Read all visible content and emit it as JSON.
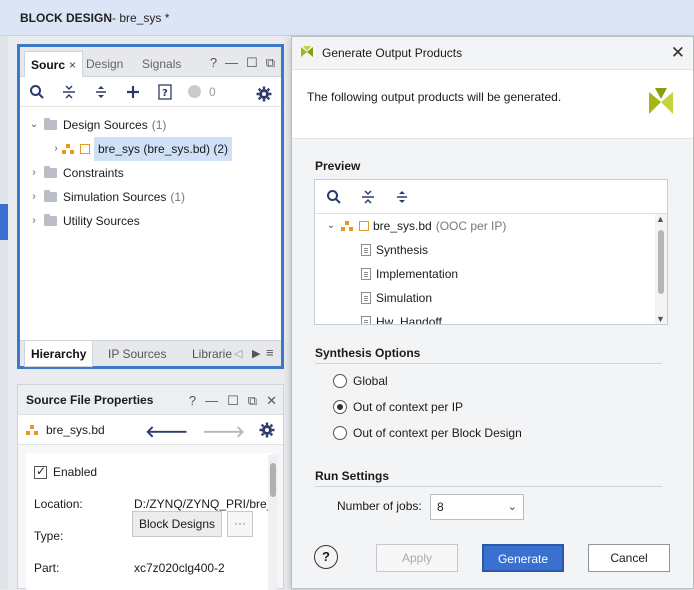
{
  "titlebar": {
    "title_bold": "BLOCK DESIGN",
    "title_rest": " - bre_sys *"
  },
  "sources": {
    "tabs": [
      "Sourc",
      "Design",
      "Signals"
    ],
    "close_glyph": "×",
    "window_icons": [
      "help-icon",
      "minimize-icon",
      "restore-icon",
      "float-icon"
    ],
    "help_glyph": "?",
    "toolbar_icons": [
      "search-icon",
      "collapse-all-icon",
      "expand-all-icon",
      "add-icon",
      "report-icon",
      "status-dot-icon",
      "gear-icon"
    ],
    "status_count": "0",
    "tree": [
      {
        "label": "Design Sources",
        "count": "(1)",
        "expanded": true
      },
      {
        "label": "bre_sys (bre_sys.bd) (2)",
        "child": true
      },
      {
        "label": "Constraints",
        "count": ""
      },
      {
        "label": "Simulation Sources",
        "count": "(1)"
      },
      {
        "label": "Utility Sources",
        "count": ""
      }
    ],
    "bottom_tabs": [
      "Hierarchy",
      "IP Sources",
      "Librarie"
    ]
  },
  "props": {
    "title": "Source File Properties",
    "file": "bre_sys.bd",
    "enabled_label": "Enabled",
    "fields": [
      {
        "label": "Location:",
        "value": "D:/ZYNQ/ZYNQ_PRI/bre_"
      },
      {
        "label": "Type:",
        "value": "Block Designs"
      },
      {
        "label": "Part:",
        "value": "xc7z020clg400-2"
      }
    ],
    "dots": "···"
  },
  "dialog": {
    "title": "Generate Output Products",
    "message": "The following output products will be generated.",
    "preview_label": "Preview",
    "preview_tree": {
      "root": "bre_sys.bd",
      "root_note": "(OOC per IP)",
      "children": [
        "Synthesis",
        "Implementation",
        "Simulation",
        "Hw_Handoff"
      ]
    },
    "synthesis_options_label": "Synthesis Options",
    "radio_options": [
      {
        "label": "Global",
        "checked": false
      },
      {
        "label": "Out of context per IP",
        "checked": true
      },
      {
        "label": "Out of context per Block Design",
        "checked": false
      }
    ],
    "run_settings_label": "Run Settings",
    "jobs_label": "Number of jobs:",
    "jobs_value": "8",
    "buttons": {
      "help": "?",
      "apply": "Apply",
      "generate": "Generate",
      "cancel": "Cancel"
    }
  },
  "colors": {
    "accent": "#3a70d0",
    "panel_border": "#3e78c9",
    "bd_icon": "#e49a1e",
    "xilinx_green": "#a3b619"
  }
}
